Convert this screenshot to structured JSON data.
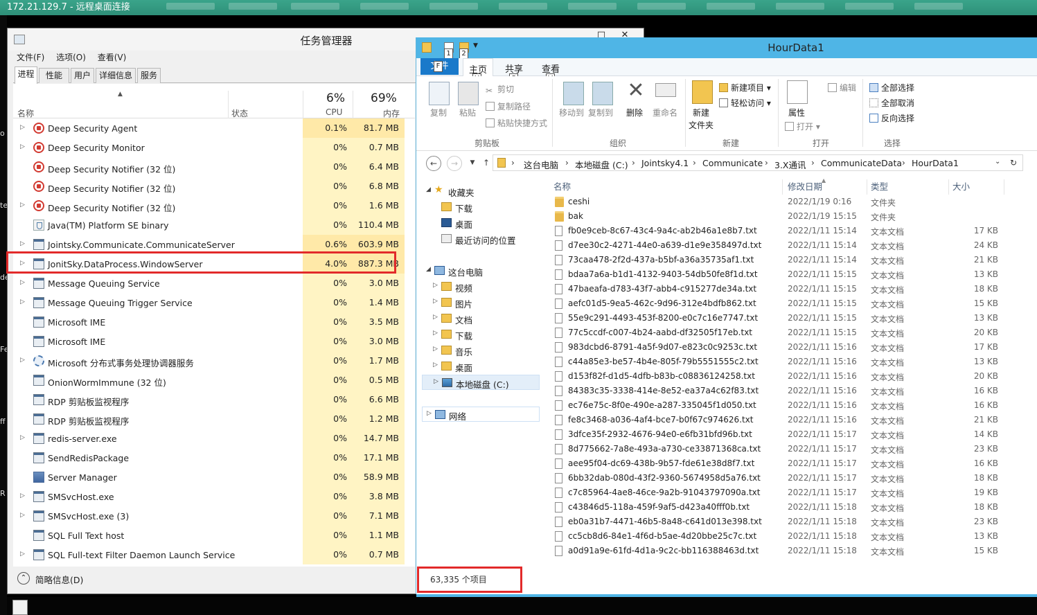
{
  "rdp": {
    "title": "172.21.129.7 - 远程桌面连接"
  },
  "desktop": {
    "fragments": [
      "o",
      "te",
      "de",
      "Fe",
      "ff",
      "R"
    ]
  },
  "task_manager": {
    "title": "任务管理器",
    "menu": [
      "文件(F)",
      "选项(O)",
      "查看(V)"
    ],
    "tabs": [
      "进程",
      "性能",
      "用户",
      "详细信息",
      "服务"
    ],
    "active_tab": "进程",
    "columns": {
      "name": "名称",
      "status": "状态",
      "cpu_pct": "6%",
      "cpu": "CPU",
      "mem_pct": "69%",
      "mem": "内存"
    },
    "processes": [
      {
        "name": "Deep Security Agent",
        "cpu": "0.1%",
        "mem": "81.7 MB",
        "expandable": true,
        "icon": "shield-icon"
      },
      {
        "name": "Deep Security Monitor",
        "cpu": "0%",
        "mem": "0.7 MB",
        "expandable": true,
        "icon": "shield-icon"
      },
      {
        "name": "Deep Security Notifier (32 位)",
        "cpu": "0%",
        "mem": "6.4 MB",
        "expandable": false,
        "icon": "shield-icon"
      },
      {
        "name": "Deep Security Notifier (32 位)",
        "cpu": "0%",
        "mem": "6.8 MB",
        "expandable": false,
        "icon": "shield-icon"
      },
      {
        "name": "Deep Security Notifier (32 位)",
        "cpu": "0%",
        "mem": "1.6 MB",
        "expandable": true,
        "icon": "shield-icon"
      },
      {
        "name": "Java(TM) Platform SE binary",
        "cpu": "0%",
        "mem": "110.4 MB",
        "expandable": false,
        "icon": "java-icon"
      },
      {
        "name": "Jointsky.Communicate.CommunicateServer",
        "cpu": "0.6%",
        "mem": "603.9 MB",
        "expandable": true,
        "icon": "window-icon"
      },
      {
        "name": "JonitSky.DataProcess.WindowServer",
        "cpu": "4.0%",
        "mem": "887.3 MB",
        "expandable": true,
        "icon": "window-icon"
      },
      {
        "name": "Message Queuing Service",
        "cpu": "0%",
        "mem": "3.0 MB",
        "expandable": true,
        "icon": "window-icon"
      },
      {
        "name": "Message Queuing Trigger Service",
        "cpu": "0%",
        "mem": "1.4 MB",
        "expandable": true,
        "icon": "window-icon"
      },
      {
        "name": "Microsoft IME",
        "cpu": "0%",
        "mem": "3.5 MB",
        "expandable": false,
        "icon": "window-icon"
      },
      {
        "name": "Microsoft IME",
        "cpu": "0%",
        "mem": "3.0 MB",
        "expandable": false,
        "icon": "window-icon"
      },
      {
        "name": "Microsoft 分布式事务处理协调器服务",
        "cpu": "0%",
        "mem": "1.7 MB",
        "expandable": true,
        "icon": "gear-icon"
      },
      {
        "name": "OnionWormImmune (32 位)",
        "cpu": "0%",
        "mem": "0.5 MB",
        "expandable": false,
        "icon": "window-icon"
      },
      {
        "name": "RDP 剪贴板监视程序",
        "cpu": "0%",
        "mem": "6.6 MB",
        "expandable": false,
        "icon": "window-icon"
      },
      {
        "name": "RDP 剪贴板监视程序",
        "cpu": "0%",
        "mem": "1.2 MB",
        "expandable": false,
        "icon": "window-icon"
      },
      {
        "name": "redis-server.exe",
        "cpu": "0%",
        "mem": "14.7 MB",
        "expandable": true,
        "icon": "window-icon"
      },
      {
        "name": "SendRedisPackage",
        "cpu": "0%",
        "mem": "17.1 MB",
        "expandable": false,
        "icon": "window-icon"
      },
      {
        "name": "Server Manager",
        "cpu": "0%",
        "mem": "58.9 MB",
        "expandable": false,
        "icon": "server-icon"
      },
      {
        "name": "SMSvcHost.exe",
        "cpu": "0%",
        "mem": "3.8 MB",
        "expandable": true,
        "icon": "window-icon"
      },
      {
        "name": "SMSvcHost.exe (3)",
        "cpu": "0%",
        "mem": "7.1 MB",
        "expandable": true,
        "icon": "window-icon"
      },
      {
        "name": "SQL Full Text host",
        "cpu": "0%",
        "mem": "1.1 MB",
        "expandable": false,
        "icon": "window-icon"
      },
      {
        "name": "SQL Full-text Filter Daemon Launch Service",
        "cpu": "0%",
        "mem": "0.7 MB",
        "expandable": true,
        "icon": "window-icon"
      }
    ],
    "highlight_index": 7,
    "footer_label": "简略信息(D)"
  },
  "explorer": {
    "title": "HourData1",
    "quick_access_keys": [
      "1",
      "2"
    ],
    "ribbon_tabs": {
      "file": "文件",
      "home": "主页",
      "share": "共享",
      "view": "查看"
    },
    "key_tips": {
      "file": "F",
      "home": "H",
      "share": "S",
      "view": "V"
    },
    "ribbon": {
      "copy": "复制",
      "paste": "粘贴",
      "cut": "剪切",
      "copy_path": "复制路径",
      "paste_shortcut": "粘贴快捷方式",
      "move_to": "移动到",
      "copy_to": "复制到",
      "delete": "删除",
      "rename": "重命名",
      "new_folder": "新建",
      "new_folder2": "文件夹",
      "new_item": "新建项目",
      "easy_access": "轻松访问",
      "properties": "属性",
      "open": "打开",
      "edit": "编辑",
      "select_all": "全部选择",
      "select_none": "全部取消",
      "invert": "反向选择",
      "groups": {
        "clipboard": "剪贴板",
        "organize": "组织",
        "new": "新建",
        "open": "打开",
        "select": "选择"
      }
    },
    "breadcrumbs": [
      "这台电脑",
      "本地磁盘 (C:)",
      "Jointsky4.1",
      "Communicate",
      "3.X通讯",
      "CommunicateData",
      "HourData1"
    ],
    "nav": {
      "favorites": "收藏夹",
      "fav_items": [
        "下载",
        "桌面",
        "最近访问的位置"
      ],
      "this_pc": "这台电脑",
      "pc_items": [
        "视频",
        "图片",
        "文档",
        "下载",
        "音乐",
        "桌面",
        "本地磁盘 (C:)"
      ],
      "network": "网络"
    },
    "columns": {
      "name": "名称",
      "date": "修改日期",
      "type": "类型",
      "size": "大小"
    },
    "files": [
      {
        "name": "ceshi",
        "date": "2022/1/19 0:16",
        "type": "文件夹",
        "size": "",
        "kind": "folder"
      },
      {
        "name": "bak",
        "date": "2022/1/19 15:15",
        "type": "文件夹",
        "size": "",
        "kind": "folder"
      },
      {
        "name": "fb0e9ceb-8c67-43c4-9a4c-ab2b46a1e8b7.txt",
        "date": "2022/1/11 15:14",
        "type": "文本文档",
        "size": "17 KB",
        "kind": "doc"
      },
      {
        "name": "d7ee30c2-4271-44e0-a639-d1e9e358497d.txt",
        "date": "2022/1/11 15:14",
        "type": "文本文档",
        "size": "24 KB",
        "kind": "doc"
      },
      {
        "name": "73caa478-2f2d-437a-b5bf-a36a35735af1.txt",
        "date": "2022/1/11 15:14",
        "type": "文本文档",
        "size": "21 KB",
        "kind": "doc"
      },
      {
        "name": "bdaa7a6a-b1d1-4132-9403-54db50fe8f1d.txt",
        "date": "2022/1/11 15:15",
        "type": "文本文档",
        "size": "13 KB",
        "kind": "doc"
      },
      {
        "name": "47baeafa-d783-43f7-abb4-c915277de34a.txt",
        "date": "2022/1/11 15:15",
        "type": "文本文档",
        "size": "18 KB",
        "kind": "doc"
      },
      {
        "name": "aefc01d5-9ea5-462c-9d96-312e4bdfb862.txt",
        "date": "2022/1/11 15:15",
        "type": "文本文档",
        "size": "15 KB",
        "kind": "doc"
      },
      {
        "name": "55e9c291-4493-453f-8200-e0c7c16e7747.txt",
        "date": "2022/1/11 15:15",
        "type": "文本文档",
        "size": "13 KB",
        "kind": "doc"
      },
      {
        "name": "77c5ccdf-c007-4b24-aabd-df32505f17eb.txt",
        "date": "2022/1/11 15:15",
        "type": "文本文档",
        "size": "20 KB",
        "kind": "doc"
      },
      {
        "name": "983dcbd6-8791-4a5f-9d07-e823c0c9253c.txt",
        "date": "2022/1/11 15:16",
        "type": "文本文档",
        "size": "17 KB",
        "kind": "doc"
      },
      {
        "name": "c44a85e3-be57-4b4e-805f-79b5551555c2.txt",
        "date": "2022/1/11 15:16",
        "type": "文本文档",
        "size": "13 KB",
        "kind": "doc"
      },
      {
        "name": "d153f82f-d1d5-4dfb-b83b-c08836124258.txt",
        "date": "2022/1/11 15:16",
        "type": "文本文档",
        "size": "20 KB",
        "kind": "doc"
      },
      {
        "name": "84383c35-3338-414e-8e52-ea37a4c62f83.txt",
        "date": "2022/1/11 15:16",
        "type": "文本文档",
        "size": "16 KB",
        "kind": "doc"
      },
      {
        "name": "ec76e75c-8f0e-490e-a287-335045f1d050.txt",
        "date": "2022/1/11 15:16",
        "type": "文本文档",
        "size": "16 KB",
        "kind": "doc"
      },
      {
        "name": "fe8c3468-a036-4af4-bce7-b0f67c974626.txt",
        "date": "2022/1/11 15:16",
        "type": "文本文档",
        "size": "21 KB",
        "kind": "doc"
      },
      {
        "name": "3dfce35f-2932-4676-94e0-e6fb31bfd96b.txt",
        "date": "2022/1/11 15:17",
        "type": "文本文档",
        "size": "14 KB",
        "kind": "doc"
      },
      {
        "name": "8d775662-7a8e-493a-a730-ce33871368ca.txt",
        "date": "2022/1/11 15:17",
        "type": "文本文档",
        "size": "23 KB",
        "kind": "doc"
      },
      {
        "name": "aee95f04-dc69-438b-9b57-fde61e38d8f7.txt",
        "date": "2022/1/11 15:17",
        "type": "文本文档",
        "size": "16 KB",
        "kind": "doc"
      },
      {
        "name": "6bb32dab-080d-43f2-9360-5674958d5a76.txt",
        "date": "2022/1/11 15:17",
        "type": "文本文档",
        "size": "18 KB",
        "kind": "doc"
      },
      {
        "name": "c7c85964-4ae8-46ce-9a2b-91043797090a.txt",
        "date": "2022/1/11 15:17",
        "type": "文本文档",
        "size": "19 KB",
        "kind": "doc"
      },
      {
        "name": "c43846d5-118a-459f-9af5-d423a40fff0b.txt",
        "date": "2022/1/11 15:18",
        "type": "文本文档",
        "size": "18 KB",
        "kind": "doc"
      },
      {
        "name": "eb0a31b7-4471-46b5-8a48-c641d013e398.txt",
        "date": "2022/1/11 15:18",
        "type": "文本文档",
        "size": "23 KB",
        "kind": "doc"
      },
      {
        "name": "cc5cb8d6-84e1-4f6d-b5ae-4d20bbe25c7c.txt",
        "date": "2022/1/11 15:18",
        "type": "文本文档",
        "size": "13 KB",
        "kind": "doc"
      },
      {
        "name": "a0d91a9e-61fd-4d1a-9c2c-bb116388463d.txt",
        "date": "2022/1/11 15:18",
        "type": "文本文档",
        "size": "15 KB",
        "kind": "doc"
      }
    ],
    "status": "63,335 个项目"
  }
}
